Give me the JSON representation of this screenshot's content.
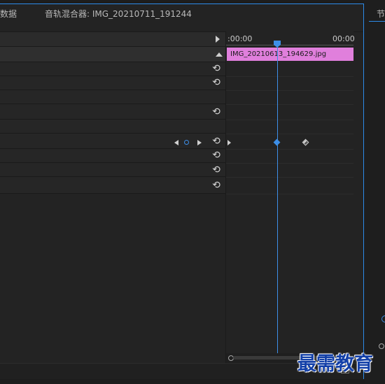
{
  "tabs": {
    "metadata_fragment": "数据",
    "audio_mixer": "音轨混合器: IMG_20210711_191244"
  },
  "side_panel_fragment": "节",
  "timeline": {
    "time_start": ":00:00",
    "time_end": "00:00",
    "clip_name": "IMG_20210613_194629.jpg"
  },
  "reset_icon_glyph": "⟲",
  "watermark": "最需教育",
  "colors": {
    "accent": "#2d8ceb",
    "clip": "#e07fdc",
    "playhead": "#3d8fe8",
    "watermark": "#1340a8"
  }
}
